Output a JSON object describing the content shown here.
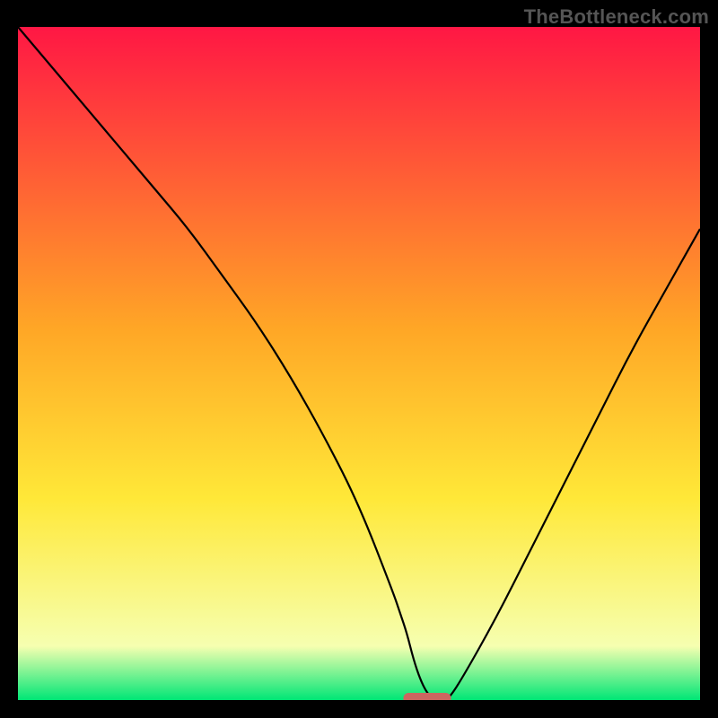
{
  "watermark": "TheBottleneck.com",
  "chart_data": {
    "type": "line",
    "title": "",
    "xlabel": "",
    "ylabel": "",
    "xlim": [
      0,
      100
    ],
    "ylim": [
      0,
      100
    ],
    "grid": false,
    "background_gradient": {
      "top_color": "#ff1744",
      "mid_color": "#ffe838",
      "bottom_color": "#00e676"
    },
    "series": [
      {
        "name": "bottleneck-curve",
        "color": "#000000",
        "x": [
          0,
          5,
          10,
          15,
          20,
          25,
          30,
          35,
          40,
          45,
          50,
          55,
          56,
          57,
          58,
          59,
          60,
          61,
          62,
          63,
          65,
          70,
          75,
          80,
          85,
          90,
          95,
          100
        ],
        "values": [
          100,
          94,
          88,
          82,
          76,
          70,
          63,
          56,
          48,
          39,
          29,
          16,
          13,
          10,
          6,
          3,
          1,
          0,
          0,
          0,
          3,
          12,
          22,
          32,
          42,
          52,
          61,
          70
        ]
      }
    ],
    "marker": {
      "name": "optimal-zone",
      "shape": "capsule",
      "color": "#cc6660",
      "x_center": 60,
      "y": 0,
      "width_x_units": 7
    }
  }
}
